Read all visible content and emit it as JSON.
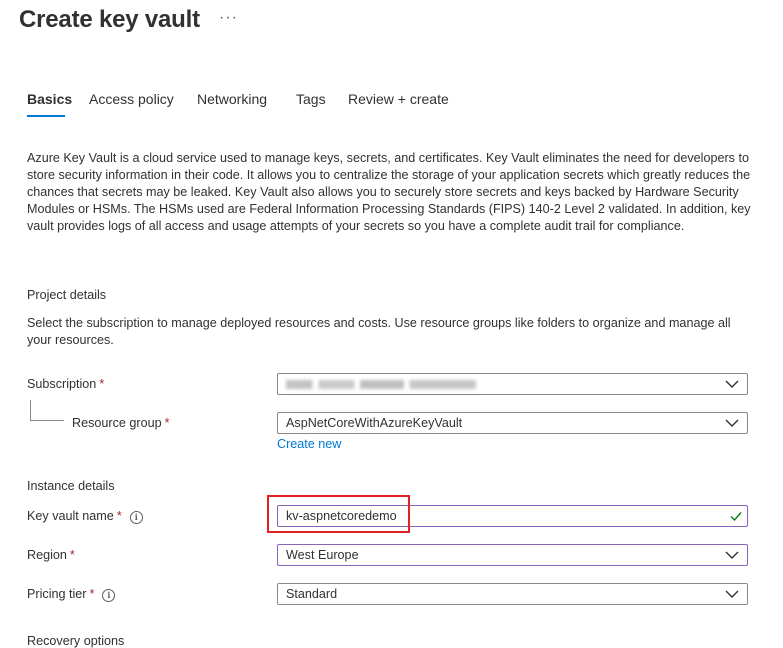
{
  "header": {
    "title": "Create key vault",
    "more_label": "···"
  },
  "tabs": [
    {
      "label": "Basics",
      "active": true
    },
    {
      "label": "Access policy",
      "active": false
    },
    {
      "label": "Networking",
      "active": false
    },
    {
      "label": "Tags",
      "active": false
    },
    {
      "label": "Review + create",
      "active": false
    }
  ],
  "description": "Azure Key Vault is a cloud service used to manage keys, secrets, and certificates. Key Vault eliminates the need for developers to store security information in their code. It allows you to centralize the storage of your application secrets which greatly reduces the chances that secrets may be leaked. Key Vault also allows you to securely store secrets and keys backed by Hardware Security Modules or HSMs. The HSMs used are Federal Information Processing Standards (FIPS) 140-2 Level 2 validated. In addition, key vault provides logs of all access and usage attempts of your secrets so you have a complete audit trail for compliance.",
  "project_details": {
    "heading": "Project details",
    "description": "Select the subscription to manage deployed resources and costs. Use resource groups like folders to organize and manage all your resources.",
    "subscription": {
      "label": "Subscription",
      "required_mark": "*",
      "value": "",
      "redacted": true
    },
    "resource_group": {
      "label": "Resource group",
      "required_mark": "*",
      "value": "AspNetCoreWithAzureKeyVault",
      "create_new_label": "Create new"
    }
  },
  "instance_details": {
    "heading": "Instance details",
    "key_vault_name": {
      "label": "Key vault name",
      "required_mark": "*",
      "value": "kv-aspnetcoredemo",
      "info_icon": "info-icon",
      "valid": true
    },
    "region": {
      "label": "Region",
      "required_mark": "*",
      "value": "West Europe"
    },
    "pricing_tier": {
      "label": "Pricing tier",
      "required_mark": "*",
      "value": "Standard",
      "info_icon": "info-icon"
    }
  },
  "recovery": {
    "heading": "Recovery options"
  },
  "colors": {
    "accent": "#0078d4",
    "required": "#a4262c",
    "valid": "#107c10",
    "highlight": "#e22222",
    "focus_border": "#8764b8"
  }
}
